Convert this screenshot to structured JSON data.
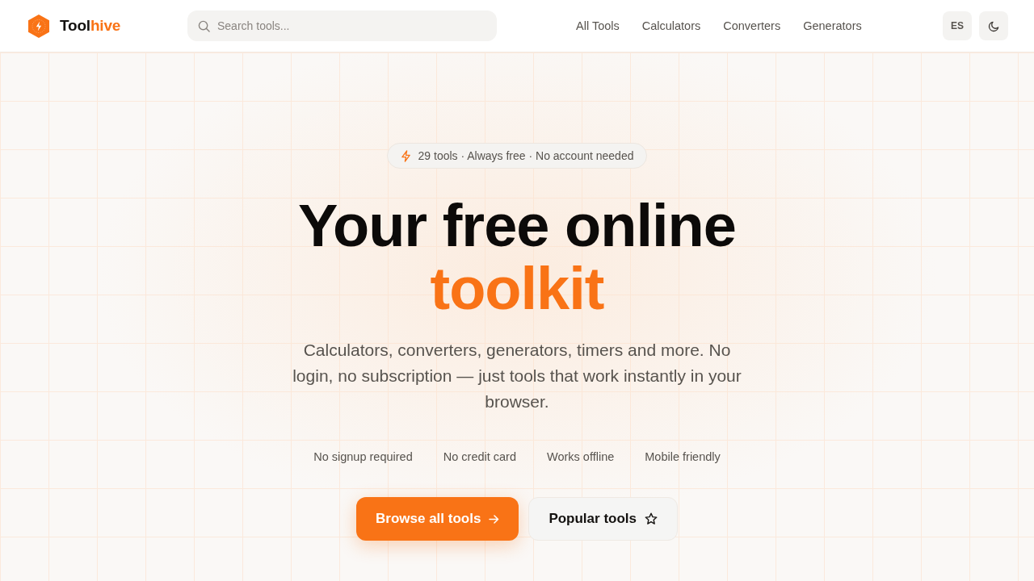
{
  "header": {
    "logo": {
      "text": "Tool",
      "accent": "hive"
    },
    "search": {
      "placeholder": "Search tools..."
    },
    "nav": [
      "All Tools",
      "Calculators",
      "Converters",
      "Generators"
    ],
    "language_button": "ES"
  },
  "hero": {
    "badge": "29 tools · Always free · No account needed",
    "title": "Your free online",
    "title_accent": "toolkit",
    "description": "Calculators, converters, generators, timers and more. No login, no subscription — just tools that work instantly in your browser.",
    "features": [
      "No signup required",
      "No credit card",
      "Works offline",
      "Mobile friendly"
    ],
    "buttons": [
      {
        "label": "Browse all tools",
        "kind": "primary"
      },
      {
        "label": "Popular tools",
        "kind": "secondary"
      }
    ]
  }
}
